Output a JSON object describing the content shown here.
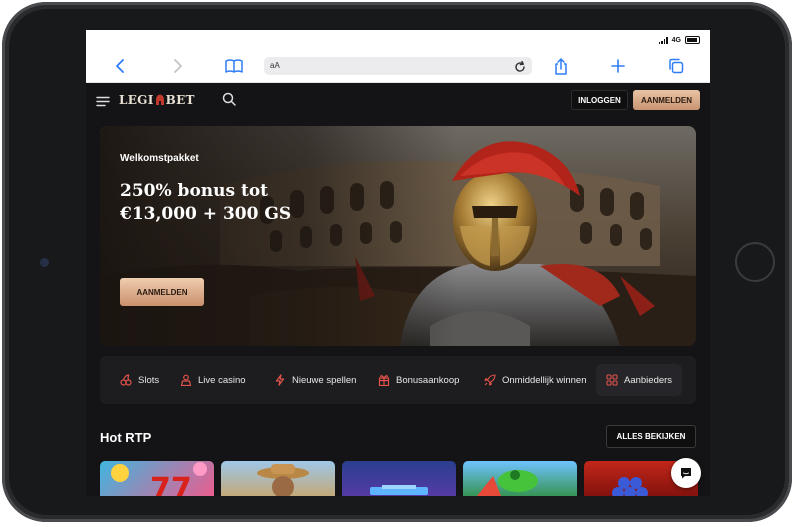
{
  "browser": {
    "network": "4G",
    "address": "aA"
  },
  "site": {
    "logo_part1": "LEGI",
    "logo_part2": "N",
    "logo_part3": "BET",
    "login_label": "INLOGGEN",
    "signup_label": "AANMELDEN"
  },
  "hero": {
    "kicker": "Welkomstpakket",
    "title_line1": "250% bonus tot",
    "title_line2": "€13,000 + 300 GS",
    "cta_label": "AANMELDEN"
  },
  "categories": [
    {
      "label": "Slots",
      "icon": "cherries-icon"
    },
    {
      "label": "Live casino",
      "icon": "dealer-icon"
    },
    {
      "label": "Nieuwe spellen",
      "icon": "lightning-icon"
    },
    {
      "label": "Bonusaankoop",
      "icon": "gift-icon"
    },
    {
      "label": "Onmiddellijk winnen",
      "icon": "rocket-icon"
    },
    {
      "label": "Aanbieders",
      "icon": "grid-icon"
    }
  ],
  "hot_rtp": {
    "title": "Hot RTP",
    "view_all_label": "ALLES BEKIJKEN"
  },
  "colors": {
    "background": "#141416",
    "accent_gold": "#d9a882",
    "brand_red": "#c0392b",
    "ios_blue": "#2f7df6"
  }
}
